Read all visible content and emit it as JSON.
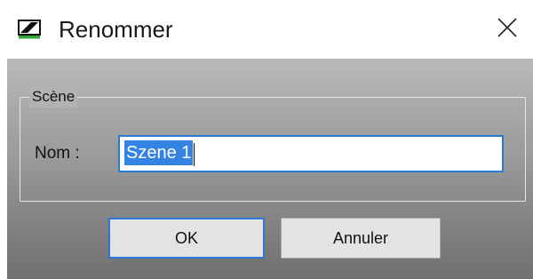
{
  "window": {
    "title": "Renommer",
    "icon": "sennheiser-logo-icon",
    "close_icon": "close-icon"
  },
  "group": {
    "label": "Scène"
  },
  "name_field": {
    "label": "Nom :",
    "value": "Szene 1",
    "selected": true
  },
  "buttons": {
    "ok_label": "OK",
    "cancel_label": "Annuler"
  },
  "colors": {
    "accent": "#2a7ad5",
    "selection": "#3584e4",
    "icon_green": "#35a635"
  }
}
